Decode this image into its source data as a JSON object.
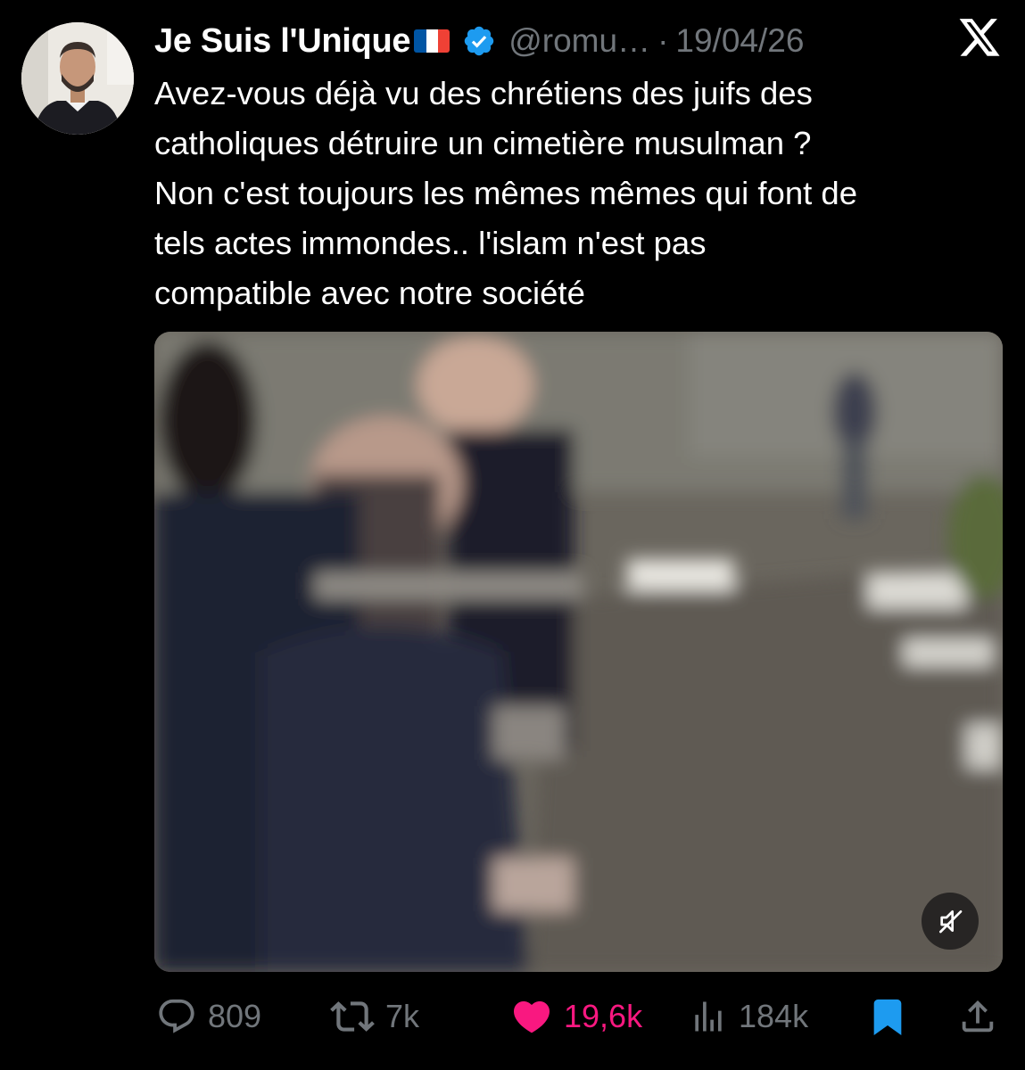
{
  "tweet": {
    "author": {
      "display_name": "Je Suis l'Unique",
      "flag_icon": "flag-france-icon",
      "verified_icon": "verified-badge-icon",
      "handle": "@romu…",
      "separator": "·",
      "date": "19/04/26"
    },
    "platform_icon": "x-logo-icon",
    "text_lines": [
      "Avez-vous déjà vu des chrétiens des juifs des",
      "catholiques détruire un cimetière musulman ?",
      "Non c'est toujours les mêmes mêmes qui font de",
      "tels actes immondes.. l'islam n'est pas",
      "compatible avec notre société"
    ],
    "media": {
      "type": "video",
      "mute_icon": "speaker-muted-icon"
    },
    "actions": {
      "replies": {
        "icon": "reply-icon",
        "count": "809"
      },
      "reposts": {
        "icon": "repost-icon",
        "count": "7k"
      },
      "likes": {
        "icon": "heart-filled-icon",
        "count": "19,6k"
      },
      "views": {
        "icon": "views-icon",
        "count": "184k"
      },
      "bookmark": {
        "icon": "bookmark-filled-icon"
      },
      "share": {
        "icon": "share-icon"
      }
    }
  },
  "colors": {
    "background": "#000000",
    "text": "#ffffff",
    "muted": "#71767b",
    "verified": "#1d9bf0",
    "like": "#f91880",
    "bookmark": "#1d9bf0"
  }
}
